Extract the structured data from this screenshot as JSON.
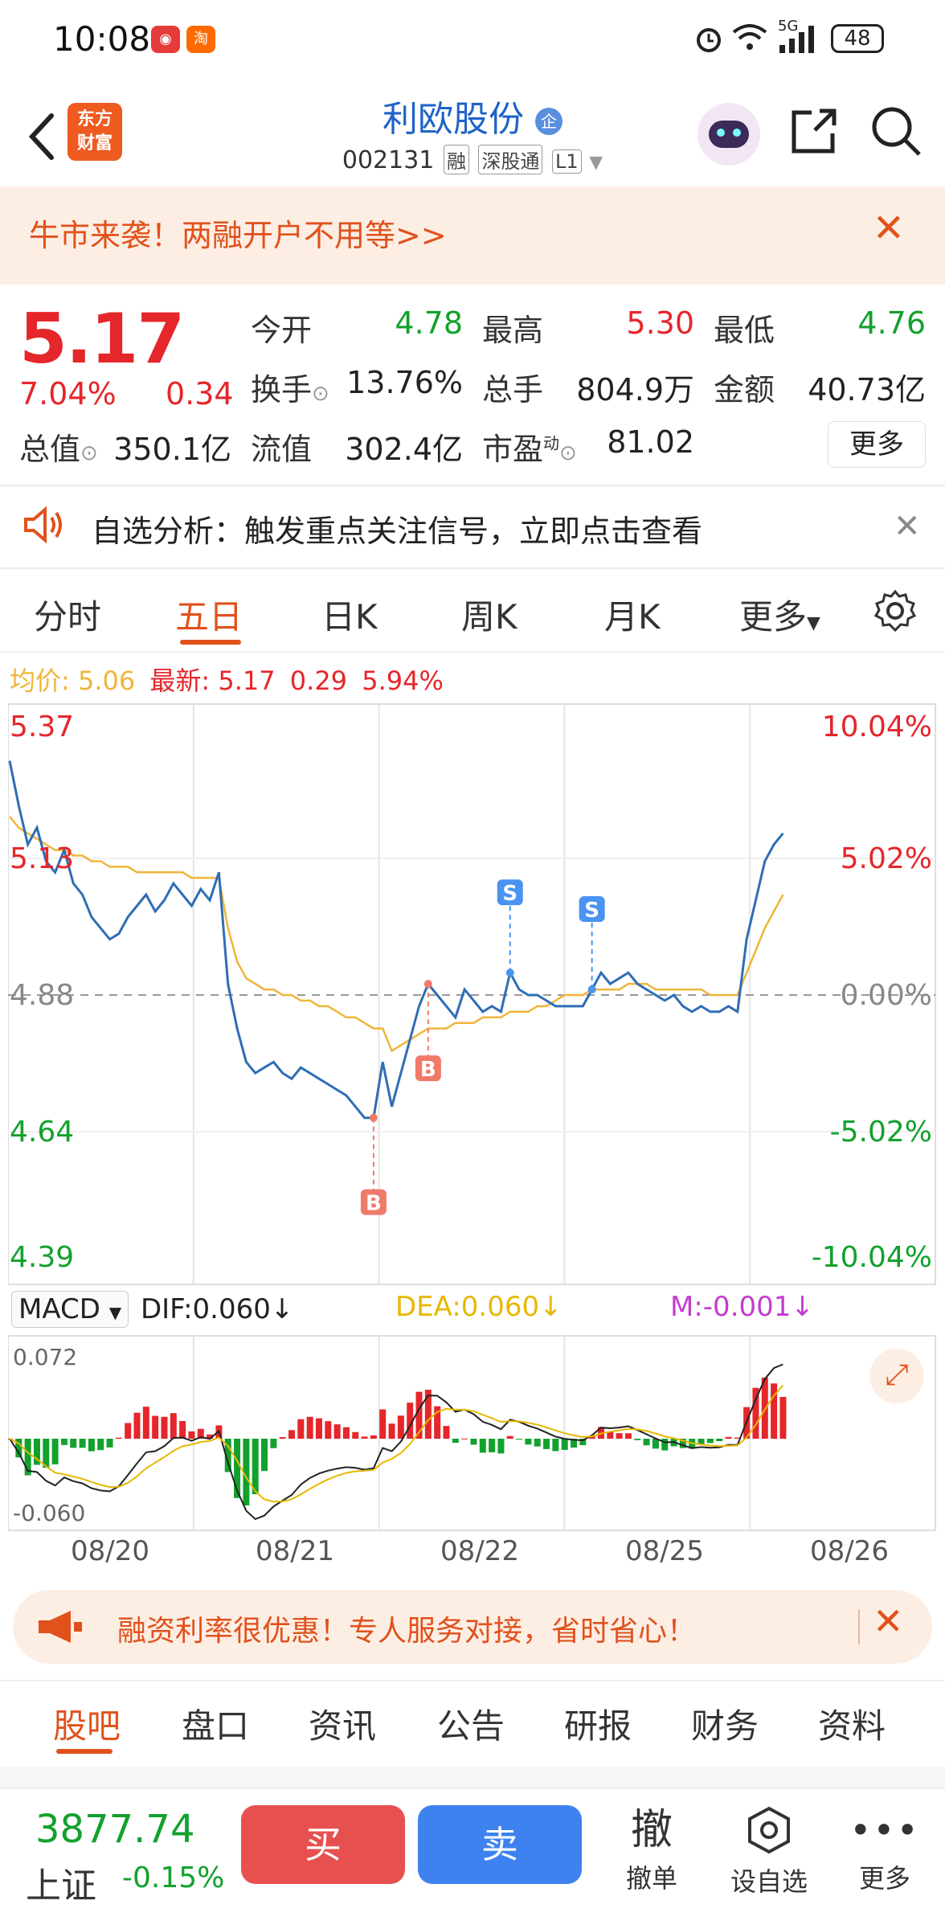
{
  "status": {
    "time": "10:08",
    "signal": "5G",
    "battery": "48"
  },
  "header": {
    "brand": [
      "东方",
      "财富"
    ],
    "name": "利欧股份",
    "name_badge": "企",
    "code": "002131",
    "tags": [
      "融",
      "深股通",
      "L1"
    ]
  },
  "promo": {
    "text": "牛市来袭！两融开户不用等>>",
    "close": "✕"
  },
  "quote": {
    "price": "5.17",
    "change_pct": "7.04%",
    "change_abs": "0.34",
    "open_label": "今开",
    "open": "4.78",
    "high_label": "最高",
    "high": "5.30",
    "low_label": "最低",
    "low": "4.76",
    "turnover_label": "换手",
    "turnover": "13.76%",
    "volume_label": "总手",
    "volume": "804.9万",
    "amount_label": "金额",
    "amount": "40.73亿",
    "mktcap_label": "总值",
    "mktcap": "350.1亿",
    "float_label": "流值",
    "float": "302.4亿",
    "pe_label": "市盈",
    "pe_sup": "动",
    "pe": "81.02",
    "more": "更多"
  },
  "analysis": {
    "text": "自选分析：触发重点关注信号，立即点击查看",
    "close": "✕"
  },
  "chart_tabs": [
    "分时",
    "五日",
    "日K",
    "周K",
    "月K",
    "更多"
  ],
  "active_chart_tab": "五日",
  "legend": {
    "avg_label": "均价:",
    "avg": "5.06",
    "last_label": "最新:",
    "last": "5.17",
    "chg": "0.29",
    "pct": "5.94%"
  },
  "colors": {
    "up": "#e5262b",
    "down": "#12a12d",
    "price_line": "#2f6db5",
    "avg_line": "#f0b53a",
    "accent": "#e0511b",
    "buy": "#e6514f",
    "sell": "#3d82ee"
  },
  "chart_data": {
    "type": "line",
    "x": [
      "08/20",
      "08/21",
      "08/22",
      "08/25",
      "08/26"
    ],
    "y_left_ticks": [
      "5.37",
      "5.13",
      "4.88",
      "4.64",
      "4.39"
    ],
    "y_right_ticks": [
      "10.04%",
      "5.02%",
      "0.00%",
      "-5.02%",
      "-10.04%"
    ],
    "ylim": [
      4.39,
      5.37
    ],
    "prev_close": 4.88,
    "series": [
      {
        "name": "最新",
        "values": [
          5.3,
          5.22,
          5.15,
          5.18,
          5.12,
          5.1,
          5.14,
          5.08,
          5.06,
          5.02,
          5.0,
          4.98,
          4.99,
          5.02,
          5.04,
          5.06,
          5.03,
          5.05,
          5.08,
          5.06,
          5.04,
          5.07,
          5.05,
          5.1,
          4.9,
          4.82,
          4.76,
          4.74,
          4.75,
          4.76,
          4.74,
          4.73,
          4.75,
          4.74,
          4.73,
          4.72,
          4.71,
          4.7,
          4.68,
          4.66,
          4.66,
          4.76,
          4.68,
          4.74,
          4.8,
          4.86,
          4.9,
          4.88,
          4.86,
          4.84,
          4.89,
          4.87,
          4.85,
          4.86,
          4.85,
          4.92,
          4.89,
          4.88,
          4.88,
          4.87,
          4.86,
          4.86,
          4.86,
          4.86,
          4.89,
          4.92,
          4.9,
          4.91,
          4.92,
          4.9,
          4.89,
          4.88,
          4.87,
          4.88,
          4.86,
          4.85,
          4.86,
          4.85,
          4.85,
          4.86,
          4.85,
          4.98,
          5.05,
          5.12,
          5.15,
          5.17
        ]
      },
      {
        "name": "均价",
        "values": [
          5.2,
          5.18,
          5.17,
          5.16,
          5.15,
          5.14,
          5.14,
          5.13,
          5.13,
          5.12,
          5.12,
          5.11,
          5.11,
          5.11,
          5.1,
          5.1,
          5.1,
          5.1,
          5.1,
          5.1,
          5.09,
          5.09,
          5.09,
          5.09,
          5.0,
          4.94,
          4.91,
          4.9,
          4.89,
          4.89,
          4.88,
          4.88,
          4.87,
          4.87,
          4.86,
          4.86,
          4.85,
          4.84,
          4.84,
          4.83,
          4.82,
          4.82,
          4.78,
          4.79,
          4.8,
          4.81,
          4.82,
          4.82,
          4.82,
          4.83,
          4.83,
          4.83,
          4.84,
          4.84,
          4.84,
          4.85,
          4.85,
          4.85,
          4.86,
          4.86,
          4.87,
          4.88,
          4.88,
          4.88,
          4.89,
          4.89,
          4.89,
          4.89,
          4.9,
          4.9,
          4.9,
          4.89,
          4.89,
          4.89,
          4.89,
          4.89,
          4.89,
          4.88,
          4.88,
          4.88,
          4.88,
          4.92,
          4.96,
          5.0,
          5.03,
          5.06
        ]
      }
    ],
    "signals": [
      {
        "label": "B",
        "index": 40
      },
      {
        "label": "B",
        "index": 46
      },
      {
        "label": "S",
        "index": 55
      },
      {
        "label": "S",
        "index": 64
      }
    ]
  },
  "macd": {
    "select": "MACD",
    "dif": "DIF:0.060",
    "dea": "DEA:0.060",
    "m": "M:-0.001",
    "top": "0.072",
    "bottom": "-0.060"
  },
  "loan_banner": {
    "text": "融资利率很优惠！专人服务对接，省时省心！",
    "close": "✕"
  },
  "bottom_tabs": [
    "股吧",
    "盘口",
    "资讯",
    "公告",
    "研报",
    "财务",
    "资料"
  ],
  "active_bottom_tab": "股吧",
  "footer": {
    "index_value": "3877.74",
    "index_name": "上证",
    "index_change": "-0.15%",
    "buy": "买",
    "sell": "卖",
    "cancel_glyph": "撤",
    "cancel": "撤单",
    "watch": "设自选",
    "more": "更多"
  }
}
